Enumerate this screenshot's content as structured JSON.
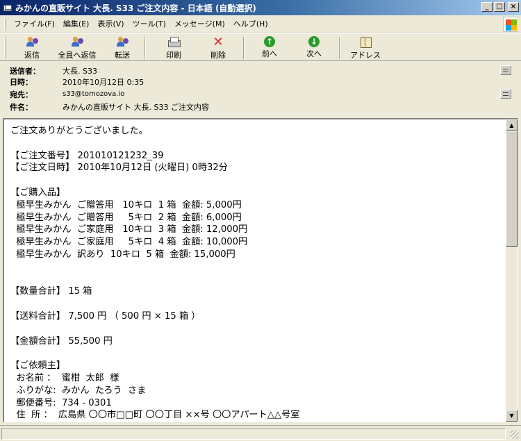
{
  "window": {
    "title": "みかんの直販サイト 大長. S33 ご注文内容 - 日本語 (自動選択)",
    "controls": {
      "minimize": "_",
      "maximize": "□",
      "close": "×"
    }
  },
  "menubar": {
    "items": [
      {
        "label": "ファイル(F)"
      },
      {
        "label": "編集(E)"
      },
      {
        "label": "表示(V)"
      },
      {
        "label": "ツール(T)"
      },
      {
        "label": "メッセージ(M)"
      },
      {
        "label": "ヘルプ(H)"
      }
    ]
  },
  "toolbar": {
    "reply": "返信",
    "reply_all": "全員へ返信",
    "forward": "転送",
    "print": "印刷",
    "delete": "削除",
    "previous": "前へ",
    "next": "次へ",
    "address_book": "アドレス",
    "prev_arrow": "↑",
    "next_arrow": "↓",
    "delete_glyph": "✕"
  },
  "header": {
    "from_label": "送信者：",
    "from_value": "大長. S33",
    "date_label": "日時：",
    "date_value": "2010年10月12日 0:35",
    "to_label": "宛先：",
    "to_value": "s33@tomozova.io",
    "subject_label": "件名：",
    "subject_value": "みかんの直販サイト 大長. S33 ご注文内容"
  },
  "body": {
    "text": "ご注文ありがとうございました。\n\n【ご注文番号】 201010121232_39\n【ご注文日時】 2010年10月12日 (火曜日) 0時32分\n\n【ご購入品】\n  極早生みかん  ご贈答用   10キロ  1 箱  金額: 5,000円\n  極早生みかん  ご贈答用     5キロ  2 箱  金額: 6,000円\n  極早生みかん  ご家庭用   10キロ  3 箱  金額: 12,000円\n  極早生みかん  ご家庭用     5キロ  4 箱  金額: 10,000円\n  極早生みかん  訳あり  10キロ  5 箱  金額: 15,000円\n\n\n【数量合計】 15 箱\n\n【送料合計】 7,500 円 （ 500 円 × 15 箱 ）\n\n【金額合計】 55,500 円\n\n【ご依頼主】\n  お名前 ：  蜜柑  太郎  様\n  ふりがな:  みかん  たろう  さま\n  郵便番号:  734 - 0301\n  住  所 ：  広島県 〇〇市□□町 〇〇丁目 ××号 〇〇アパート△△号室"
  },
  "scrollbar": {
    "up": "▲",
    "down": "▼"
  }
}
